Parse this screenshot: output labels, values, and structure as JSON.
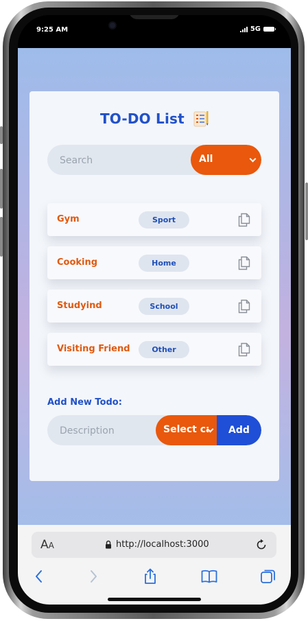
{
  "status_bar": {
    "time": "9:25 AM",
    "network": "5G"
  },
  "app": {
    "title": "TO-DO List",
    "search": {
      "placeholder": "Search",
      "value": ""
    },
    "filter": {
      "selected": "All"
    },
    "todos": [
      {
        "label": "Gym",
        "category": "Sport"
      },
      {
        "label": "Cooking",
        "category": "Home"
      },
      {
        "label": "Studyind",
        "category": "School"
      },
      {
        "label": "Visiting Friend",
        "category": "Other"
      }
    ],
    "add_form": {
      "heading": "Add New Todo:",
      "description_placeholder": "Description",
      "category_placeholder": "Select category",
      "add_label": "Add"
    }
  },
  "browser": {
    "text_size_label": "AA",
    "url": "http://localhost:3000"
  },
  "colors": {
    "accent_orange": "#e9580c",
    "accent_blue": "#2151c9"
  }
}
